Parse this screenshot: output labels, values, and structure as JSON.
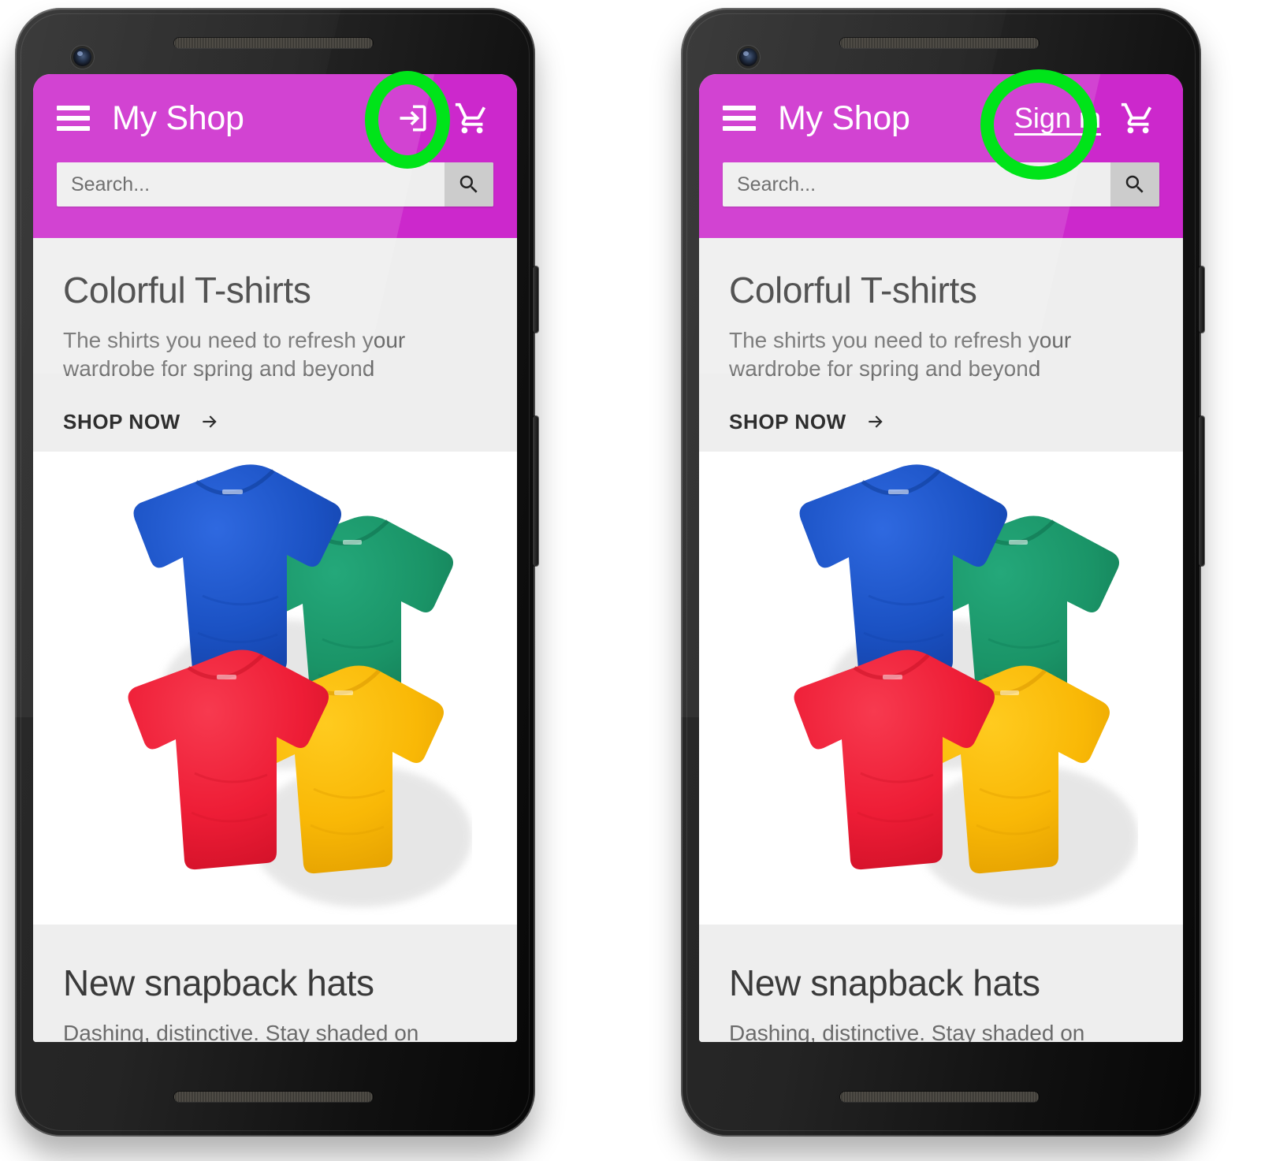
{
  "meta": {
    "comparison_note": "Two Android phone mockups side by side of the same 'My Shop' storefront; the highlighted top-bar sign-in affordance differs between them."
  },
  "colors": {
    "app_bar_magenta": "#cc28cc",
    "annotation_green": "#00e419",
    "content_gray": "#eeeeee",
    "photo_white": "#ffffff",
    "title_text": "#3a3a3a",
    "body_text": "#6b6b6b",
    "device_black": "#1a1a1a",
    "search_field": "#eeeeee",
    "search_button": "#cccccc",
    "shirt_blue": "#1b52c4",
    "shirt_green": "#1a9467",
    "shirt_red": "#ee1d36",
    "shirt_yellow": "#f9b806"
  },
  "app_bar": {
    "menu_icon": "hamburger-menu-icon",
    "title": "My Shop",
    "cart_icon": "shopping-cart-icon"
  },
  "search": {
    "placeholder": "Search...",
    "value": "",
    "button_icon": "search-icon"
  },
  "hero_card": {
    "title": "Colorful T-shirts",
    "subtitle": "The shirts you need to refresh your wardrobe for spring and beyond",
    "cta_label": "SHOP NOW",
    "cta_icon": "arrow-right-icon",
    "photo_alt": "Four folded t-shirts in blue, green, red and yellow"
  },
  "next_card": {
    "title": "New snapback hats",
    "subtitle": "Dashing, distinctive. Stay shaded on sunny"
  },
  "phones": [
    {
      "id": "phone-left",
      "variant": "icon",
      "sign_in_icon": "login-icon",
      "sign_in_label": "",
      "annotation": {
        "shape": "tall-ellipse",
        "target": "login-icon-button"
      }
    },
    {
      "id": "phone-right",
      "variant": "text",
      "sign_in_icon": "",
      "sign_in_label": "Sign in",
      "annotation": {
        "shape": "round-ellipse",
        "target": "sign-in-text-button"
      }
    }
  ]
}
